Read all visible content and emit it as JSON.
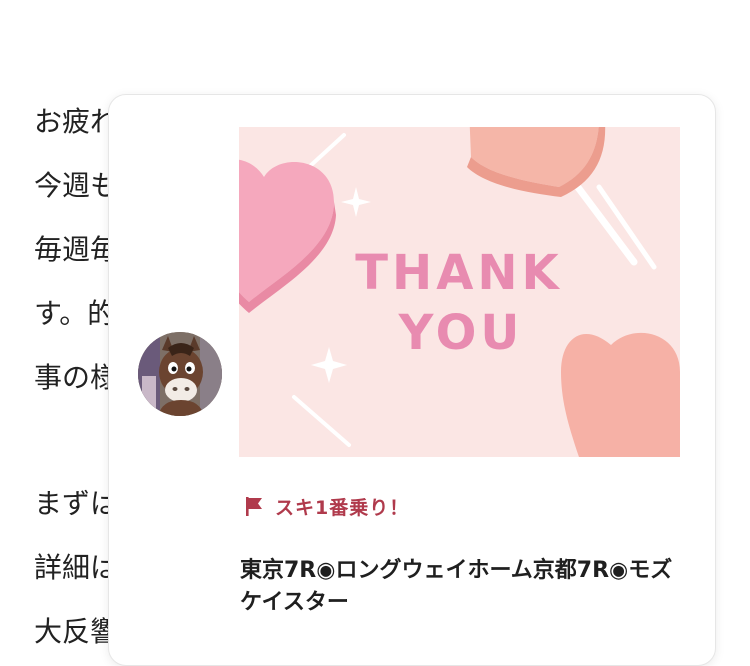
{
  "background_article": {
    "lines": [
      "お疲れ",
      "今週も",
      "毎週毎",
      "す。的",
      "事の様",
      "まずは",
      "詳細は",
      "大反響"
    ]
  },
  "popup": {
    "avatar_name": "horse-mascot-avatar",
    "thank_you_lines": [
      "THANK",
      "YOU"
    ],
    "first_like_label": "スキ1番乗り！",
    "article_title": "東京7R◉ロングウェイホーム京都7R◉モズケイスター",
    "colors": {
      "accent": "#b03a4c",
      "card_bg": "#fbe6e4",
      "thank_text": "#e88bb0"
    }
  }
}
